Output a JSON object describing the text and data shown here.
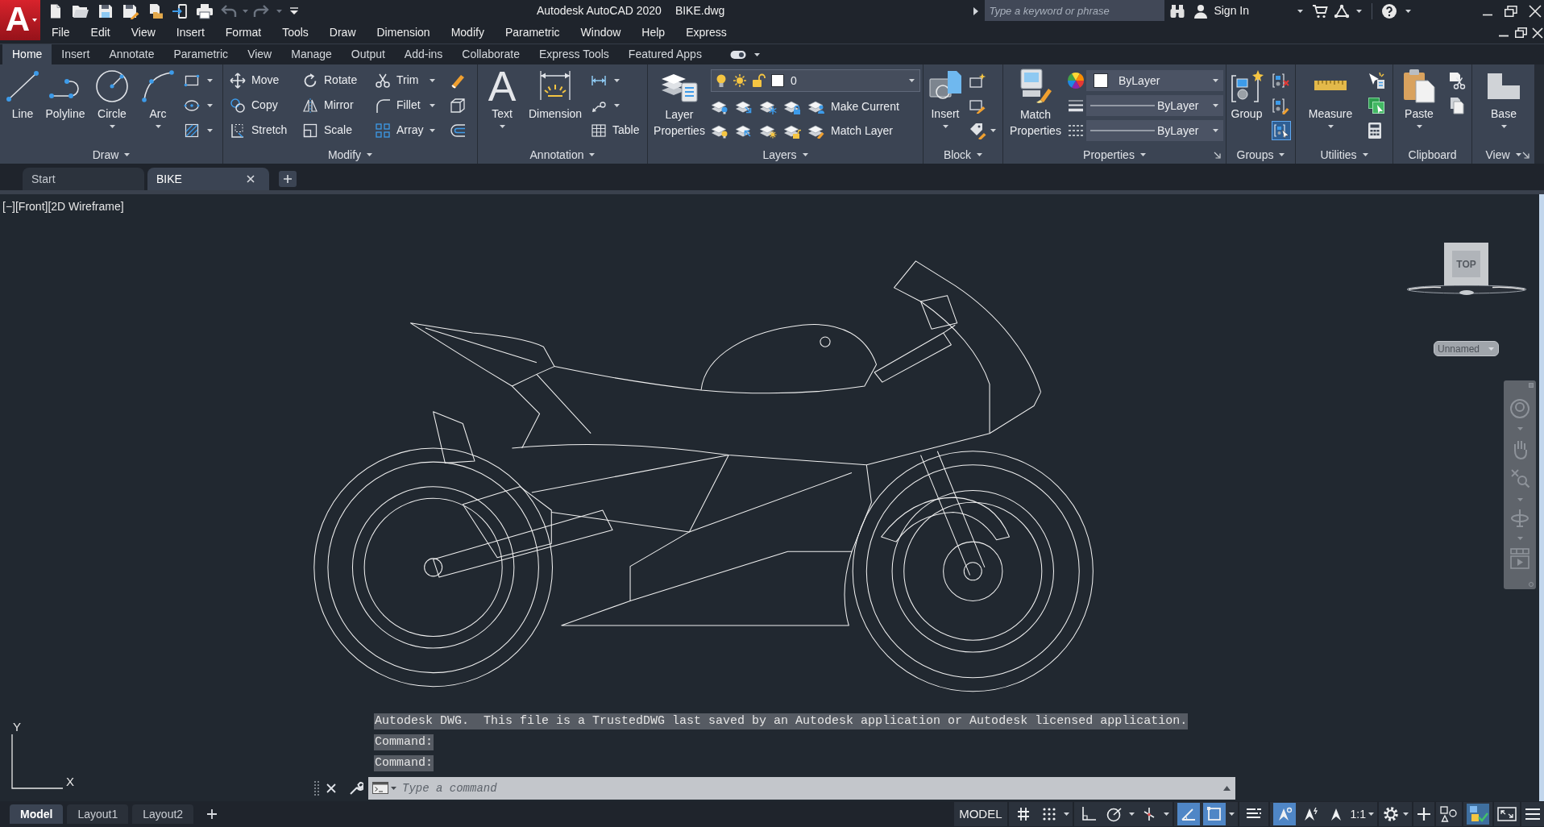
{
  "application_button": {
    "glyph": "A"
  },
  "quick_access": {
    "undo": {
      "disabled": true
    },
    "redo": {
      "disabled": true
    }
  },
  "window": {
    "title": "Autodesk AutoCAD 2020",
    "document": "BIKE.dwg"
  },
  "search": {
    "placeholder": "Type a keyword or phrase"
  },
  "account": {
    "label": "Sign In"
  },
  "menu_bar": [
    "File",
    "Edit",
    "View",
    "Insert",
    "Format",
    "Tools",
    "Draw",
    "Dimension",
    "Modify",
    "Parametric",
    "Window",
    "Help",
    "Express"
  ],
  "ribbon_tabs": [
    {
      "label": "Home",
      "selected": true
    },
    {
      "label": "Insert",
      "selected": false
    },
    {
      "label": "Annotate",
      "selected": false
    },
    {
      "label": "Parametric",
      "selected": false
    },
    {
      "label": "View",
      "selected": false
    },
    {
      "label": "Manage",
      "selected": false
    },
    {
      "label": "Output",
      "selected": false
    },
    {
      "label": "Add-ins",
      "selected": false
    },
    {
      "label": "Collaborate",
      "selected": false
    },
    {
      "label": "Express Tools",
      "selected": false
    },
    {
      "label": "Featured Apps",
      "selected": false
    }
  ],
  "ribbon_panels": [
    {
      "kind": "draw",
      "title": "Draw",
      "tools": [
        "Line",
        "Polyline",
        "Circle",
        "Arc"
      ]
    },
    {
      "kind": "modify",
      "title": "Modify",
      "tools": [
        "Move",
        "Copy",
        "Stretch",
        "Rotate",
        "Mirror",
        "Scale",
        "Trim",
        "Fillet",
        "Array"
      ]
    },
    {
      "kind": "annotation",
      "title": "Annotation",
      "text_glyph": "A",
      "tools": [
        "Text",
        "Dimension",
        "Table"
      ]
    },
    {
      "kind": "layers",
      "title": "Layers",
      "tools": [
        "Layer Properties",
        "Make Current",
        "Match Layer"
      ],
      "current_layer": "0"
    },
    {
      "kind": "block",
      "title": "Block",
      "tools": [
        "Insert"
      ]
    },
    {
      "kind": "properties",
      "title": "Properties",
      "tools": [
        "Match Properties"
      ],
      "object_color": "ByLayer",
      "lineweight": "ByLayer",
      "linetype": "ByLayer"
    },
    {
      "kind": "groups",
      "title": "Groups",
      "tools": [
        "Group"
      ],
      "group_selection": {
        "on": true
      }
    },
    {
      "kind": "utilities",
      "title": "Utilities",
      "tools": [
        "Measure"
      ]
    },
    {
      "kind": "clipboard",
      "title": "Clipboard",
      "tools": [
        "Paste"
      ]
    },
    {
      "kind": "view",
      "title": "View",
      "tools": [
        "Base"
      ]
    }
  ],
  "document_tabs": [
    {
      "label": "Start",
      "selected": false
    },
    {
      "label": "BIKE",
      "selected": true
    }
  ],
  "viewport_controls": [
    "[−]",
    "[Front]",
    "[2D Wireframe]"
  ],
  "ucs": {
    "x_axis": "X",
    "y_axis": "Y"
  },
  "viewcube": {
    "face": "TOP",
    "ucs_menu": "Unnamed"
  },
  "command_history": [
    "Autodesk DWG.  This file is a TrustedDWG last saved by an Autodesk application or Autodesk licensed application.",
    "Command:",
    "Command:"
  ],
  "command_line": {
    "placeholder": "Type a command"
  },
  "layout_tabs": [
    {
      "label": "Model",
      "selected": true
    },
    {
      "label": "Layout1",
      "selected": false
    },
    {
      "label": "Layout2",
      "selected": false
    }
  ],
  "status_bar": {
    "space": "MODEL",
    "toggles": [
      {
        "kind": "grid",
        "on": false
      },
      {
        "kind": "snap",
        "on": false
      },
      {
        "kind": "ortho",
        "on": false
      },
      {
        "kind": "polar",
        "on": false
      },
      {
        "kind": "isodraft",
        "on": false
      },
      {
        "kind": "tracking",
        "on": true
      },
      {
        "kind": "osnap",
        "on": true
      },
      {
        "kind": "lineweight",
        "on": false
      },
      {
        "kind": "annotation_visibility",
        "on": true
      },
      {
        "kind": "autoscale",
        "on": false
      },
      {
        "kind": "annotation_scale",
        "on": false
      }
    ],
    "annotation_scale": "1:1"
  }
}
